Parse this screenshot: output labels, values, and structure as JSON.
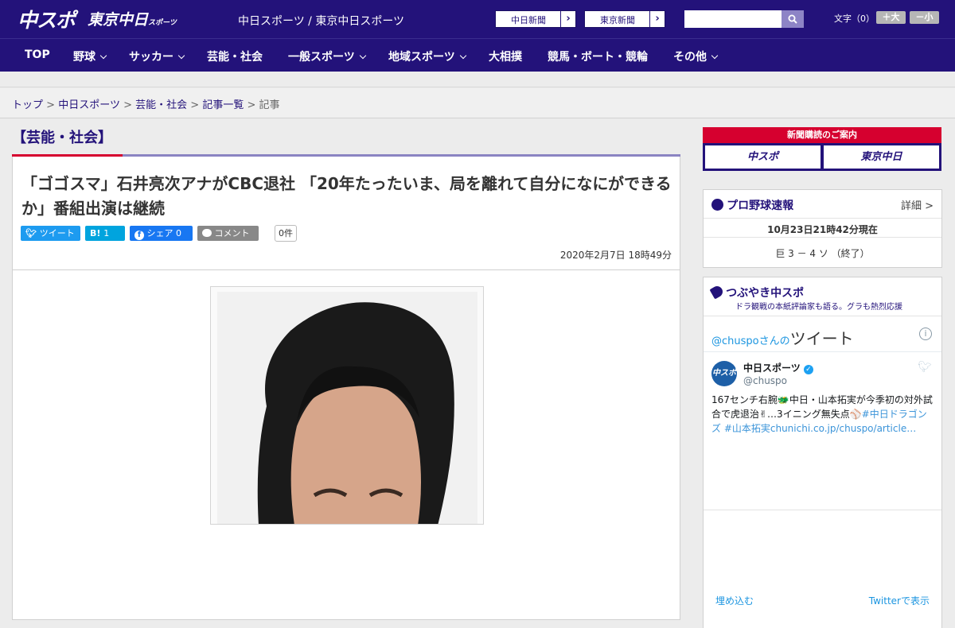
{
  "header": {
    "logo": "中スポ",
    "logo2": "東京中日",
    "logo2_small": "スポーツ",
    "site_name": "中日スポーツ / 東京中日スポーツ",
    "paper1": "中日新聞",
    "paper2": "東京新聞",
    "font_label": "文字（0）",
    "font_large": "＋大",
    "font_small": "－小"
  },
  "nav": {
    "items": [
      "TOP",
      "野球",
      "サッカー",
      "芸能・社会",
      "一般スポーツ",
      "地域スポーツ",
      "大相撲",
      "競馬・ボート・競輪",
      "その他"
    ]
  },
  "breadcrumb": {
    "top": "トップ",
    "sep": ">",
    "chunichi": "中日スポーツ",
    "category": "芸能・社会",
    "list": "記事一覧",
    "current": "記事"
  },
  "article": {
    "category": "【芸能・社会】",
    "title": "「ゴゴスマ」石井亮次アナがCBC退社 「20年たったいま、局を離れて自分になにができるか」番組出演は継続",
    "tweet": "ツイート",
    "hatena": "B!",
    "hatena_count": "1",
    "facebook": "シェア",
    "facebook_count": "0",
    "comment": "コメント",
    "comment_count": "0件",
    "date": "2020年2月7日 18時49分"
  },
  "sidebar": {
    "subscribe": "新聞購読のご案内",
    "sub_logo1": "中スポ",
    "sub_logo2": "東京中日",
    "baseball_title": "プロ野球速報",
    "detail": "詳細 >",
    "score_time": "10月23日21時42分現在",
    "score": "巨 3 － 4 ソ （終了）",
    "tsubuyaki_title": "つぶやき中スポ",
    "tsubuyaki_sub": "ドラ観戦の本紙評論家も語る。グラも熱烈応援",
    "tweets_of_prefix": "@chuspo",
    "tweets_of_mid": "さんの",
    "tweets_of": "ツイート",
    "account_name": "中日スポーツ",
    "account_handle": "@chuspo",
    "avatar_text": "中スポ",
    "tweet_line1": "167センチ右腕🐲中日・山本拓実が今季初の対外試",
    "tweet_line2": "合で虎退治✌…3イニング無失点⚾",
    "tweet_tag1": "#中日ドラゴン",
    "tweet_line3": "ズ #山本拓実chunichi.co.jp/chuspo/article…",
    "embed": "埋め込む",
    "view_on_twitter": "Twitterで表示"
  }
}
